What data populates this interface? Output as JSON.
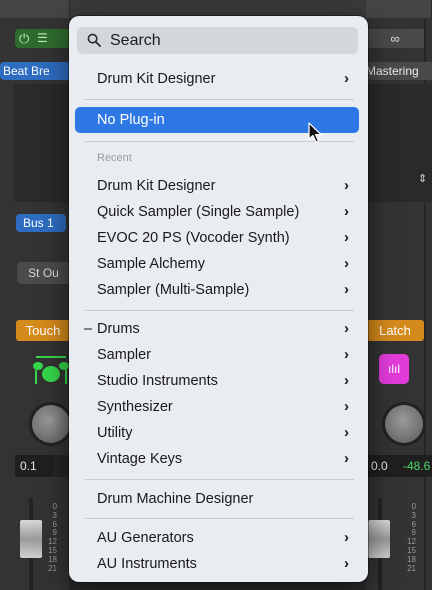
{
  "colors": {
    "selection": "#2d78e4",
    "menu_bg": "#e9ecf1",
    "accent_green": "#2f6b2d",
    "accent_blue": "#2d6cc0",
    "accent_orange": "#d58a1c",
    "accent_pink": "#e23bd9",
    "meter_green": "#4cd96a"
  },
  "background": {
    "left_strip": {
      "region_label": "Beat Bre",
      "send_label": "Bus 1",
      "output_label": "St Ou",
      "automation_label": "Touch",
      "value": "0.1",
      "icons": [
        "power-icon",
        "eq-sliders-icon",
        "drum-kit-icon"
      ]
    },
    "right_strip": {
      "link_icon": "link-icon",
      "region_label": "Mastering",
      "automation_label": "Latch",
      "value": "0.0",
      "peak": "-48.6",
      "icons": [
        "link-icon",
        "chevron-updown-icon",
        "waveform-icon"
      ]
    },
    "fader_scale": [
      "0",
      "3",
      "6",
      "9",
      "12",
      "15",
      "18",
      "21"
    ]
  },
  "menu": {
    "search_placeholder": "Search",
    "items": [
      {
        "label": "Drum Kit Designer",
        "submenu": true
      },
      {
        "label": "No Plug-in",
        "submenu": false,
        "selected": true
      }
    ],
    "recent_header": "Recent",
    "recent": [
      {
        "label": "Drum Kit Designer",
        "submenu": true
      },
      {
        "label": "Quick Sampler (Single Sample)",
        "submenu": true
      },
      {
        "label": "EVOC 20 PS (Vocoder Synth)",
        "submenu": true
      },
      {
        "label": "Sample Alchemy",
        "submenu": true
      },
      {
        "label": "Sampler (Multi-Sample)",
        "submenu": true
      }
    ],
    "categories": [
      {
        "label": "Drums",
        "submenu": true,
        "mark": "–"
      },
      {
        "label": "Sampler",
        "submenu": true
      },
      {
        "label": "Studio Instruments",
        "submenu": true
      },
      {
        "label": "Synthesizer",
        "submenu": true
      },
      {
        "label": "Utility",
        "submenu": true
      },
      {
        "label": "Vintage Keys",
        "submenu": true
      }
    ],
    "drum_machine": {
      "label": "Drum Machine Designer",
      "submenu": false
    },
    "au": [
      {
        "label": "AU Generators",
        "submenu": true
      },
      {
        "label": "AU Instruments",
        "submenu": true
      }
    ],
    "chevron": "›"
  }
}
